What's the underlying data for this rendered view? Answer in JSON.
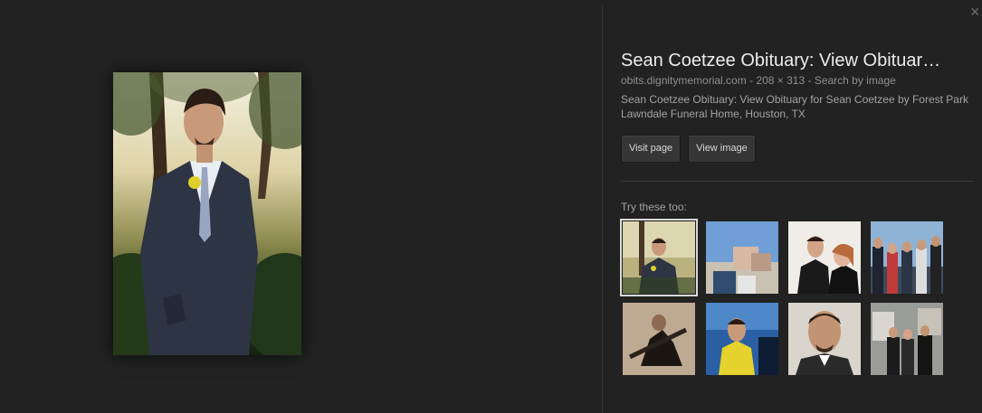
{
  "result": {
    "title": "Sean Coetzee Obituary: View Obituar…",
    "source": "obits.dignitymemorial.com",
    "dimensions": "208 × 313",
    "search_by_image": "Search by image",
    "description": "Sean Coetzee Obituary: View Obituary for Sean Coetzee by Forest Park Lawndale Funeral Home, Houston, TX"
  },
  "buttons": {
    "visit_page": "Visit page",
    "view_image": "View image"
  },
  "related": {
    "label": "Try these too:",
    "thumbnails": [
      {
        "name": "related-thumb-1",
        "selected": true
      },
      {
        "name": "related-thumb-2"
      },
      {
        "name": "related-thumb-3"
      },
      {
        "name": "related-thumb-4"
      },
      {
        "name": "related-thumb-5"
      },
      {
        "name": "related-thumb-6"
      },
      {
        "name": "related-thumb-7"
      },
      {
        "name": "related-thumb-8"
      }
    ]
  },
  "icons": {
    "close": "close-icon"
  },
  "colors": {
    "background": "#222222",
    "title": "#ececec",
    "meta": "#8f8f8f",
    "button": "#363636"
  }
}
